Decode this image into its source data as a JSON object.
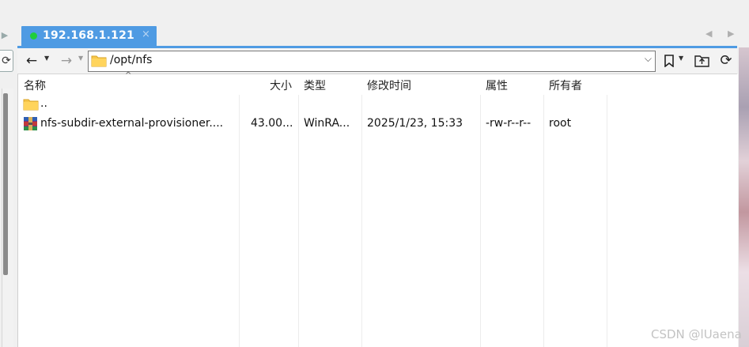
{
  "tab": {
    "host": "192.168.1.121",
    "close": "×"
  },
  "tab_nav": {
    "prev": "◀",
    "next": "▶"
  },
  "left_pane": {
    "arrow": "▶",
    "refresh": "⟳"
  },
  "toolbar": {
    "back": "←",
    "forward": "→",
    "caret": "▼",
    "path": "/opt/nfs",
    "path_dropdown": "⌵",
    "bookmark": "🔖",
    "up_dir": "⤴",
    "refresh": "⟳"
  },
  "columns": {
    "name": "名称",
    "size": "大小",
    "type": "类型",
    "modified": "修改时间",
    "attributes": "属性",
    "owner": "所有者",
    "sort_indicator": "^"
  },
  "rows": [
    {
      "name": "..",
      "size": "",
      "type": "",
      "modified": "",
      "attributes": "",
      "owner": "",
      "icon": "folder-icon"
    },
    {
      "name": "nfs-subdir-external-provisioner....",
      "size": "43.00...",
      "type": "WinRA...",
      "modified": "2025/1/23, 15:33",
      "attributes": "-rw-r--r--",
      "owner": "root",
      "icon": "winrar-archive-icon"
    }
  ],
  "watermark": "CSDN @lUaena",
  "colors": {
    "accent": "#4f9be3",
    "status_dot": "#1fce3b",
    "folder": "#f6c64a"
  }
}
